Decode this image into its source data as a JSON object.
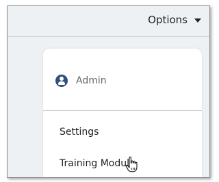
{
  "header": {
    "options_label": "Options",
    "caret_icon": "caret-down-icon"
  },
  "menu": {
    "user": {
      "icon": "user-icon",
      "label": "Admin"
    },
    "items": [
      {
        "label": "Settings"
      },
      {
        "label": "Training Module"
      }
    ]
  },
  "cursor": {
    "icon": "hand-pointer-icon"
  }
}
